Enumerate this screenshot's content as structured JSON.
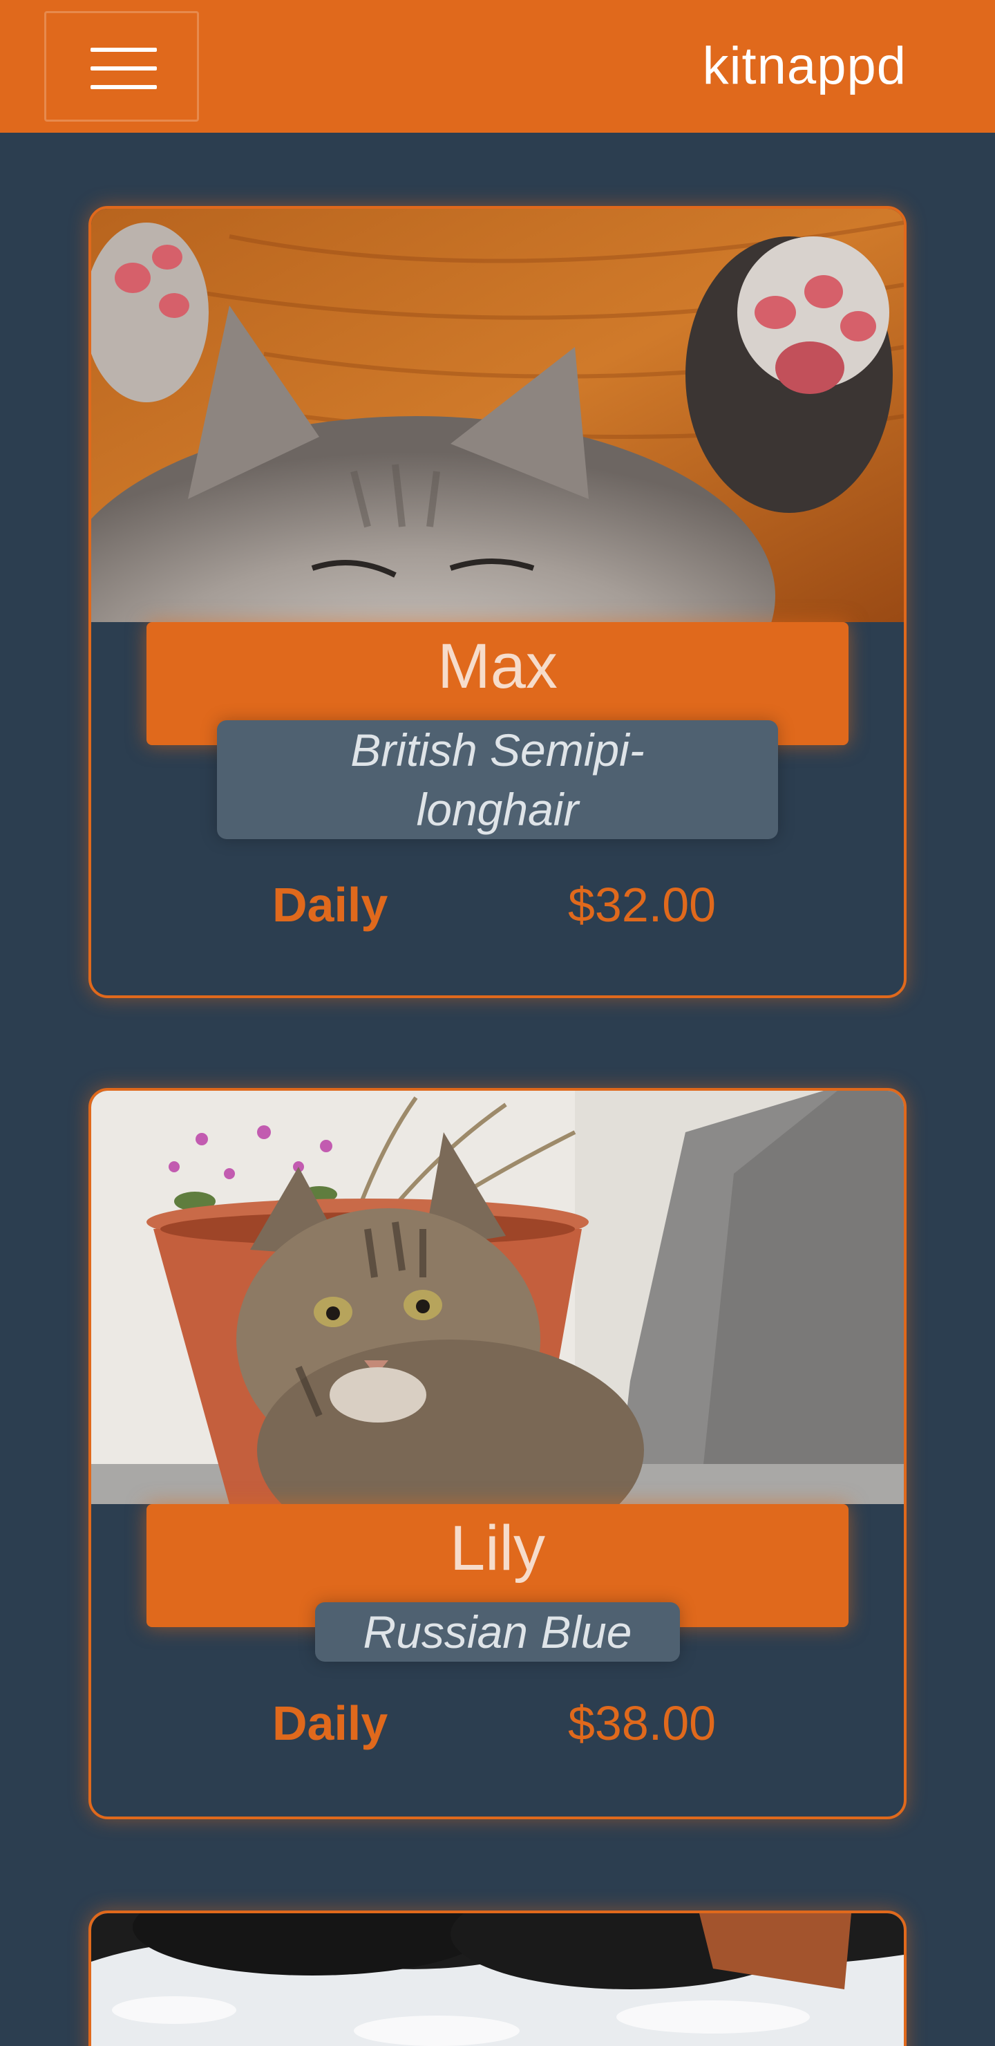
{
  "app": {
    "brand": "kitnappd"
  },
  "nav": {
    "menu_icon": "hamburger-menu-icon"
  },
  "colors": {
    "accent": "#e0691c",
    "background": "#2c3e50",
    "badge": "#4f6171"
  },
  "cats": [
    {
      "name": "Max",
      "breed_line1": "British Semipi-",
      "breed_line2": "longhair",
      "rate_label": "Daily",
      "price": "$32.00"
    },
    {
      "name": "Lily",
      "breed": "Russian Blue",
      "rate_label": "Daily",
      "price": "$38.00"
    }
  ]
}
